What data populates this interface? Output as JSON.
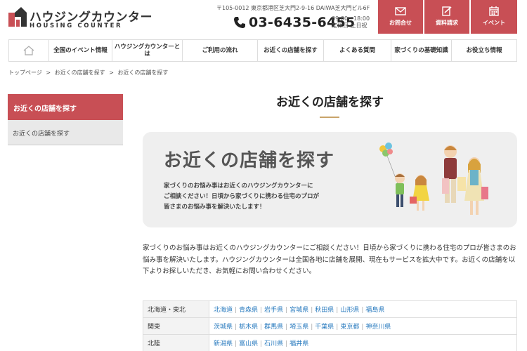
{
  "brand": {
    "name_jp": "ハウジングカウンター",
    "name_en": "HOUSING COUNTER"
  },
  "contact": {
    "address": "〒105-0012 東京都港区芝大門2-9-16 DAIWA芝大門ビル6F",
    "phone": "03-6435-6455",
    "hours": "09:00～18:00",
    "closed": "定休日 土日祝"
  },
  "header_buttons": [
    {
      "label": "お問合せ",
      "icon": "envelope-icon"
    },
    {
      "label": "資料請求",
      "icon": "document-edit-icon"
    },
    {
      "label": "イベント",
      "icon": "calendar-icon"
    }
  ],
  "nav": {
    "home_icon": "home-icon",
    "items": [
      {
        "label": "全国のイベント情報"
      },
      {
        "label": "ハウジングカウンターとは"
      },
      {
        "label": "ご利用の流れ"
      },
      {
        "label": "お近くの店舗を探す"
      },
      {
        "label": "よくある質問"
      },
      {
        "label": "家づくりの基礎知識"
      },
      {
        "label": "お役立ち情報"
      }
    ]
  },
  "breadcrumb": [
    "トップページ",
    ">",
    "お近くの店舗を探す",
    ">",
    "お近くの店舗を探す"
  ],
  "sidebar": {
    "heading": "お近くの店舗を探す",
    "items": [
      {
        "label": "お近くの店舗を探す"
      }
    ]
  },
  "main": {
    "title": "お近くの店舗を探す",
    "banner": {
      "title": "お近くの店舗を探す",
      "text1": "家づくりのお悩み事はお近くのハウジングカウンターに",
      "text2": "ご相談ください！日頃から家づくりに携わる住宅のプロが",
      "text3": "皆さまのお悩み事を解決いたします！"
    },
    "intro": "家づくりのお悩み事はお近くのハウジングカウンターにご相談ください！日頃から家づくりに携わる住宅のプロが皆さまのお悩み事を解決いたします。ハウジングカウンターは全国各地に店舗を展開、現在もサービスを拡大中です。お近くの店舗を以下よりお探しいただき、お気軽にお問い合わせください。",
    "regions": [
      {
        "name": "北海道・東北",
        "prefectures": [
          "北海道",
          "青森県",
          "岩手県",
          "宮城県",
          "秋田県",
          "山形県",
          "福島県"
        ]
      },
      {
        "name": "関東",
        "prefectures": [
          "茨城県",
          "栃木県",
          "群馬県",
          "埼玉県",
          "千葉県",
          "東京都",
          "神奈川県"
        ]
      },
      {
        "name": "北陸",
        "prefectures": [
          "新潟県",
          "富山県",
          "石川県",
          "福井県"
        ]
      }
    ]
  },
  "colors": {
    "accent": "#c84f55",
    "link": "#2a7bbf",
    "gold": "#c9a46a"
  }
}
